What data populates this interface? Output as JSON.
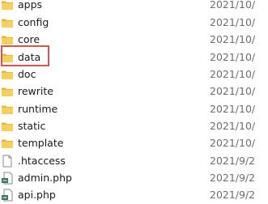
{
  "files": [
    {
      "name": "apps",
      "date": "2021/10/",
      "icon": "folder-icon"
    },
    {
      "name": "config",
      "date": "2021/10/",
      "icon": "folder-icon"
    },
    {
      "name": "core",
      "date": "2021/10/",
      "icon": "folder-icon"
    },
    {
      "name": "data",
      "date": "2021/10/",
      "icon": "folder-icon",
      "highlighted": true
    },
    {
      "name": "doc",
      "date": "2021/10/",
      "icon": "folder-icon"
    },
    {
      "name": "rewrite",
      "date": "2021/10/",
      "icon": "folder-icon"
    },
    {
      "name": "runtime",
      "date": "2021/10/",
      "icon": "folder-icon"
    },
    {
      "name": "static",
      "date": "2021/10/",
      "icon": "folder-icon"
    },
    {
      "name": "template",
      "date": "2021/10/",
      "icon": "folder-icon"
    },
    {
      "name": ".htaccess",
      "date": "2021/9/2",
      "icon": "file-icon"
    },
    {
      "name": "admin.php",
      "date": "2021/9/2",
      "icon": "php-file-icon"
    },
    {
      "name": "api.php",
      "date": "2021/9/2",
      "icon": "php-file-icon"
    }
  ],
  "colors": {
    "folder": "#f7cf5c",
    "folder_dark": "#e8b63c",
    "highlight": "#d9534f",
    "date_text": "#6d6d6d"
  }
}
